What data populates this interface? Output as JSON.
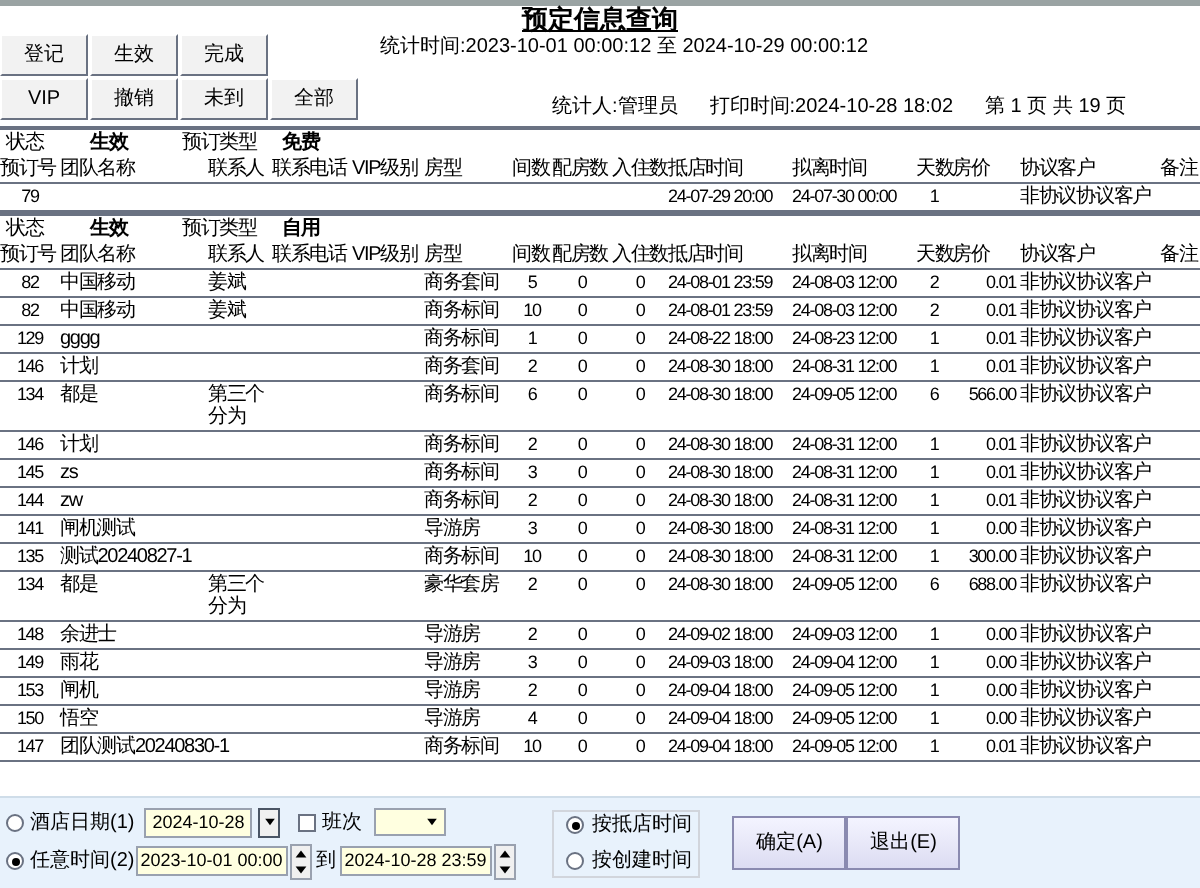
{
  "title": "预定信息查询",
  "stat_period": "统计时间:2023-10-01 00:00:12 至 2024-10-29 00:00:12",
  "filter_buttons": [
    [
      "登记",
      "生效",
      "完成"
    ],
    [
      "VIP",
      "撤销",
      "未到",
      "全部"
    ]
  ],
  "statistician": "统计人:管理员",
  "print_time": "打印时间:2024-10-28 18:02",
  "page_info": "第 1 页 共 19 页",
  "groups": [
    {
      "status_label": "状态",
      "status": "生效",
      "type_label": "预订类型",
      "type": "免费",
      "columns": [
        "预订号",
        "团队名称",
        "联系人",
        "联系电话",
        "VIP级别",
        "房型",
        "间数",
        "配房数",
        "入住数",
        "抵店时间",
        "拟离时间",
        "天数",
        "房价",
        "协议客户",
        "备注"
      ],
      "rows": [
        {
          "id": "79",
          "arrival": "24-07-29 20:00",
          "departure": "24-07-30 00:00",
          "days": "1",
          "client": "非协议协议客户"
        }
      ]
    },
    {
      "status_label": "状态",
      "status": "生效",
      "type_label": "预订类型",
      "type": "自用",
      "columns": [
        "预订号",
        "团队名称",
        "联系人",
        "联系电话",
        "VIP级别",
        "房型",
        "间数",
        "配房数",
        "入住数",
        "抵店时间",
        "拟离时间",
        "天数",
        "房价",
        "协议客户",
        "备注"
      ],
      "rows": [
        {
          "id": "82",
          "team": "中国移动",
          "contact": "姜斌",
          "room_type": "商务套间",
          "rooms": "5",
          "assigned": "0",
          "checked_in": "0",
          "arrival": "24-08-01 23:59",
          "departure": "24-08-03 12:00",
          "days": "2",
          "rate": "0.01",
          "client": "非协议协议客户"
        },
        {
          "id": "82",
          "team": "中国移动",
          "contact": "姜斌",
          "room_type": "商务标间",
          "rooms": "10",
          "assigned": "0",
          "checked_in": "0",
          "arrival": "24-08-01 23:59",
          "departure": "24-08-03 12:00",
          "days": "2",
          "rate": "0.01",
          "client": "非协议协议客户"
        },
        {
          "id": "129",
          "team": "gggg",
          "room_type": "商务标间",
          "rooms": "1",
          "assigned": "0",
          "checked_in": "0",
          "arrival": "24-08-22 18:00",
          "departure": "24-08-23 12:00",
          "days": "1",
          "rate": "0.01",
          "client": "非协议协议客户"
        },
        {
          "id": "146",
          "team": "计划",
          "room_type": "商务套间",
          "rooms": "2",
          "assigned": "0",
          "checked_in": "0",
          "arrival": "24-08-30 18:00",
          "departure": "24-08-31 12:00",
          "days": "1",
          "rate": "0.01",
          "client": "非协议协议客户"
        },
        {
          "id": "134",
          "team": "都是",
          "contact": "第三个分为",
          "room_type": "商务标间",
          "rooms": "6",
          "assigned": "0",
          "checked_in": "0",
          "arrival": "24-08-30 18:00",
          "departure": "24-09-05 12:00",
          "days": "6",
          "rate": "566.00",
          "client": "非协议协议客户"
        },
        {
          "id": "146",
          "team": "计划",
          "room_type": "商务标间",
          "rooms": "2",
          "assigned": "0",
          "checked_in": "0",
          "arrival": "24-08-30 18:00",
          "departure": "24-08-31 12:00",
          "days": "1",
          "rate": "0.01",
          "client": "非协议协议客户"
        },
        {
          "id": "145",
          "team": "zs",
          "room_type": "商务标间",
          "rooms": "3",
          "assigned": "0",
          "checked_in": "0",
          "arrival": "24-08-30 18:00",
          "departure": "24-08-31 12:00",
          "days": "1",
          "rate": "0.01",
          "client": "非协议协议客户"
        },
        {
          "id": "144",
          "team": "zw",
          "room_type": "商务标间",
          "rooms": "2",
          "assigned": "0",
          "checked_in": "0",
          "arrival": "24-08-30 18:00",
          "departure": "24-08-31 12:00",
          "days": "1",
          "rate": "0.01",
          "client": "非协议协议客户"
        },
        {
          "id": "141",
          "team": "闸机测试",
          "room_type": "导游房",
          "rooms": "3",
          "assigned": "0",
          "checked_in": "0",
          "arrival": "24-08-30 18:00",
          "departure": "24-08-31 12:00",
          "days": "1",
          "rate": "0.00",
          "client": "非协议协议客户"
        },
        {
          "id": "135",
          "team": "测试20240827-1",
          "room_type": "商务标间",
          "rooms": "10",
          "assigned": "0",
          "checked_in": "0",
          "arrival": "24-08-30 18:00",
          "departure": "24-08-31 12:00",
          "days": "1",
          "rate": "300.00",
          "client": "非协议协议客户"
        },
        {
          "id": "134",
          "team": "都是",
          "contact": "第三个分为",
          "room_type": "豪华套房",
          "rooms": "2",
          "assigned": "0",
          "checked_in": "0",
          "arrival": "24-08-30 18:00",
          "departure": "24-09-05 12:00",
          "days": "6",
          "rate": "688.00",
          "client": "非协议协议客户"
        },
        {
          "id": "148",
          "team": "余进士",
          "room_type": "导游房",
          "rooms": "2",
          "assigned": "0",
          "checked_in": "0",
          "arrival": "24-09-02 18:00",
          "departure": "24-09-03 12:00",
          "days": "1",
          "rate": "0.00",
          "client": "非协议协议客户"
        },
        {
          "id": "149",
          "team": "雨花",
          "room_type": "导游房",
          "rooms": "3",
          "assigned": "0",
          "checked_in": "0",
          "arrival": "24-09-03 18:00",
          "departure": "24-09-04 12:00",
          "days": "1",
          "rate": "0.00",
          "client": "非协议协议客户"
        },
        {
          "id": "153",
          "team": "闸机",
          "room_type": "导游房",
          "rooms": "2",
          "assigned": "0",
          "checked_in": "0",
          "arrival": "24-09-04 18:00",
          "departure": "24-09-05 12:00",
          "days": "1",
          "rate": "0.00",
          "client": "非协议协议客户"
        },
        {
          "id": "150",
          "team": "悟空",
          "room_type": "导游房",
          "rooms": "4",
          "assigned": "0",
          "checked_in": "0",
          "arrival": "24-09-04 18:00",
          "departure": "24-09-05 12:00",
          "days": "1",
          "rate": "0.00",
          "client": "非协议协议客户"
        },
        {
          "id": "147",
          "team": "团队测试20240830-1",
          "room_type": "商务标间",
          "rooms": "10",
          "assigned": "0",
          "checked_in": "0",
          "arrival": "24-09-04 18:00",
          "departure": "24-09-05 12:00",
          "days": "1",
          "rate": "0.01",
          "client": "非协议协议客户"
        }
      ]
    }
  ],
  "query": {
    "hotel_date": {
      "label": "酒店日期(1)",
      "selected": false,
      "value": "2024-10-28"
    },
    "shift": {
      "label": "班次",
      "checked": false
    },
    "any_time": {
      "label": "任意时间(2)",
      "selected": true,
      "from": "2023-10-01 00:00",
      "to_label": "到",
      "to": "2024-10-28 23:59"
    },
    "time_basis": [
      {
        "label": "按抵店时间",
        "selected": true
      },
      {
        "label": "按创建时间",
        "selected": false
      }
    ],
    "buttons": [
      "确定(A)",
      "退出(E)"
    ]
  }
}
